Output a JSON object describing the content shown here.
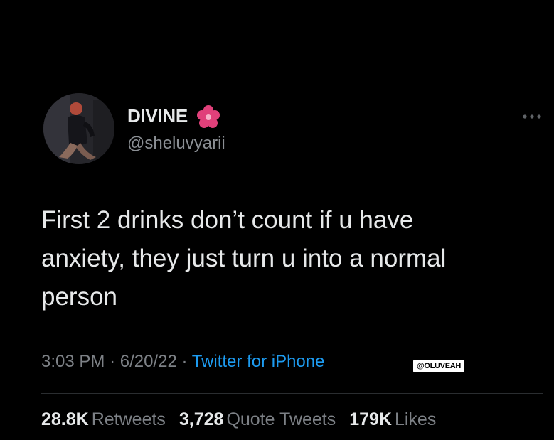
{
  "author": {
    "display_name": "DIVINE",
    "handle": "@sheluvyarii"
  },
  "tweet": {
    "text": "First 2 drinks don’t count if u have\nanxiety, they just turn u into a normal\nperson",
    "time": "3:03 PM",
    "separator": "·",
    "date": "6/20/22",
    "source": "Twitter for iPhone"
  },
  "watermark": "@OLUVEAH",
  "stats": {
    "retweets_count": "28.8K",
    "retweets_label": "Retweets",
    "quotes_count": "3,728",
    "quotes_label": "Quote Tweets",
    "likes_count": "179K",
    "likes_label": "Likes"
  },
  "colors": {
    "background": "#000000",
    "text": "#e7e9ea",
    "secondary": "#7d8186",
    "link": "#1d9bf0",
    "flower": "#e0407a"
  },
  "icons": {
    "flower": "flower-icon",
    "more": "more-icon"
  }
}
